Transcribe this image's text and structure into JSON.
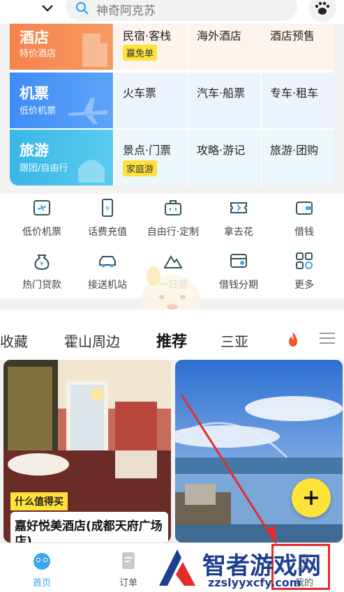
{
  "header": {
    "search_placeholder": "神奇阿克苏"
  },
  "services": [
    {
      "lead": {
        "title": "酒店",
        "subtitle": "特价酒店"
      },
      "cells": [
        {
          "label": "民宿·客栈",
          "tag": "赢免单"
        },
        {
          "label": "海外酒店",
          "tag": ""
        },
        {
          "label": "酒店预售",
          "tag": ""
        }
      ]
    },
    {
      "lead": {
        "title": "机票",
        "subtitle": "低价机票"
      },
      "cells": [
        {
          "label": "火车票",
          "tag": ""
        },
        {
          "label": "汽车·船票",
          "tag": ""
        },
        {
          "label": "专车·租车",
          "tag": ""
        }
      ]
    },
    {
      "lead": {
        "title": "旅游",
        "subtitle": "跟团/自由行"
      },
      "cells": [
        {
          "label": "景点·门票",
          "tag": "家庭游"
        },
        {
          "label": "攻略·游记",
          "tag": ""
        },
        {
          "label": "旅游·团购",
          "tag": ""
        }
      ]
    }
  ],
  "quick_icons": [
    {
      "label": "低价机票",
      "icon": "flight-ticket-icon"
    },
    {
      "label": "话费充值",
      "icon": "phone-recharge-icon"
    },
    {
      "label": "自由行·定制",
      "icon": "suitcase-icon"
    },
    {
      "label": "拿去花",
      "icon": "ticket-icon"
    },
    {
      "label": "借钱",
      "icon": "wallet-icon"
    },
    {
      "label": "热门贷款",
      "icon": "money-bag-icon"
    },
    {
      "label": "接送机站",
      "icon": "car-icon"
    },
    {
      "label": "一日游",
      "icon": "mountain-icon"
    },
    {
      "label": "借钱分期",
      "icon": "card-user-icon"
    },
    {
      "label": "更多",
      "icon": "grid-more-icon"
    }
  ],
  "feed_tabs": [
    {
      "label": "收藏",
      "active": false
    },
    {
      "label": "霍山周边",
      "active": false
    },
    {
      "label": "推荐",
      "active": true
    },
    {
      "label": "三亚",
      "active": false
    }
  ],
  "cards": [
    {
      "tag": "什么值得买",
      "title": "嘉好悦美酒店(成都天府广场店)"
    }
  ],
  "bottom_nav": [
    {
      "label": "首页",
      "active": true
    },
    {
      "label": "订单",
      "active": false
    },
    {
      "label": "我的",
      "active": false
    }
  ],
  "watermark": {
    "title": "智者游戏网",
    "url": "zzslyyxcfy.com"
  },
  "colors": {
    "accent_yellow": "#ffe23a",
    "hotel": "#f6834e",
    "flight": "#3e8cf6",
    "travel": "#39b7e6",
    "highlight_box": "#e52b2b"
  }
}
